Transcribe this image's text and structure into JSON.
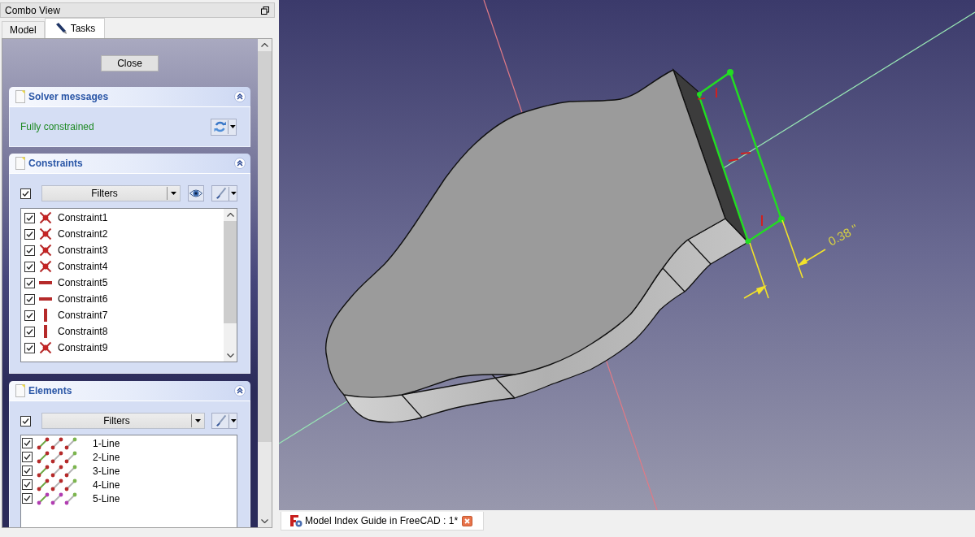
{
  "combo_view": {
    "title": "Combo View",
    "tabs": [
      {
        "label": "Model",
        "selected": false
      },
      {
        "label": "Tasks",
        "selected": true
      }
    ]
  },
  "task_panel": {
    "close_button": "Close",
    "solver_messages": {
      "title": "Solver messages",
      "expanded": true,
      "message": "Fully constrained"
    },
    "constraints": {
      "title": "Constraints",
      "expanded": true,
      "show_all_checked": true,
      "filter": "Filters",
      "items": [
        {
          "label": "Constraint1",
          "kind": "coincident",
          "checked": true
        },
        {
          "label": "Constraint2",
          "kind": "coincident",
          "checked": true
        },
        {
          "label": "Constraint3",
          "kind": "coincident",
          "checked": true
        },
        {
          "label": "Constraint4",
          "kind": "coincident",
          "checked": true
        },
        {
          "label": "Constraint5",
          "kind": "horizontal",
          "checked": true
        },
        {
          "label": "Constraint6",
          "kind": "horizontal",
          "checked": true
        },
        {
          "label": "Constraint7",
          "kind": "vertical",
          "checked": true
        },
        {
          "label": "Constraint8",
          "kind": "vertical",
          "checked": true
        },
        {
          "label": "Constraint9",
          "kind": "coincident",
          "checked": true
        }
      ]
    },
    "elements": {
      "title": "Elements",
      "expanded": true,
      "show_all_checked": true,
      "filter": "Filters",
      "items": [
        {
          "label": "1-Line",
          "checked": true,
          "color": "#b52a2a"
        },
        {
          "label": "2-Line",
          "checked": true,
          "color": "#b52a2a"
        },
        {
          "label": "3-Line",
          "checked": true,
          "color": "#b52a2a"
        },
        {
          "label": "4-Line",
          "checked": true,
          "color": "#b52a2a"
        },
        {
          "label": "5-Line",
          "checked": true,
          "color": "#b13db1"
        }
      ]
    }
  },
  "viewport": {
    "dimension_label": "0.38 \""
  },
  "document_tabs": [
    {
      "label": "Model Index Guide in FreeCAD : 1*",
      "selected": true
    }
  ]
}
